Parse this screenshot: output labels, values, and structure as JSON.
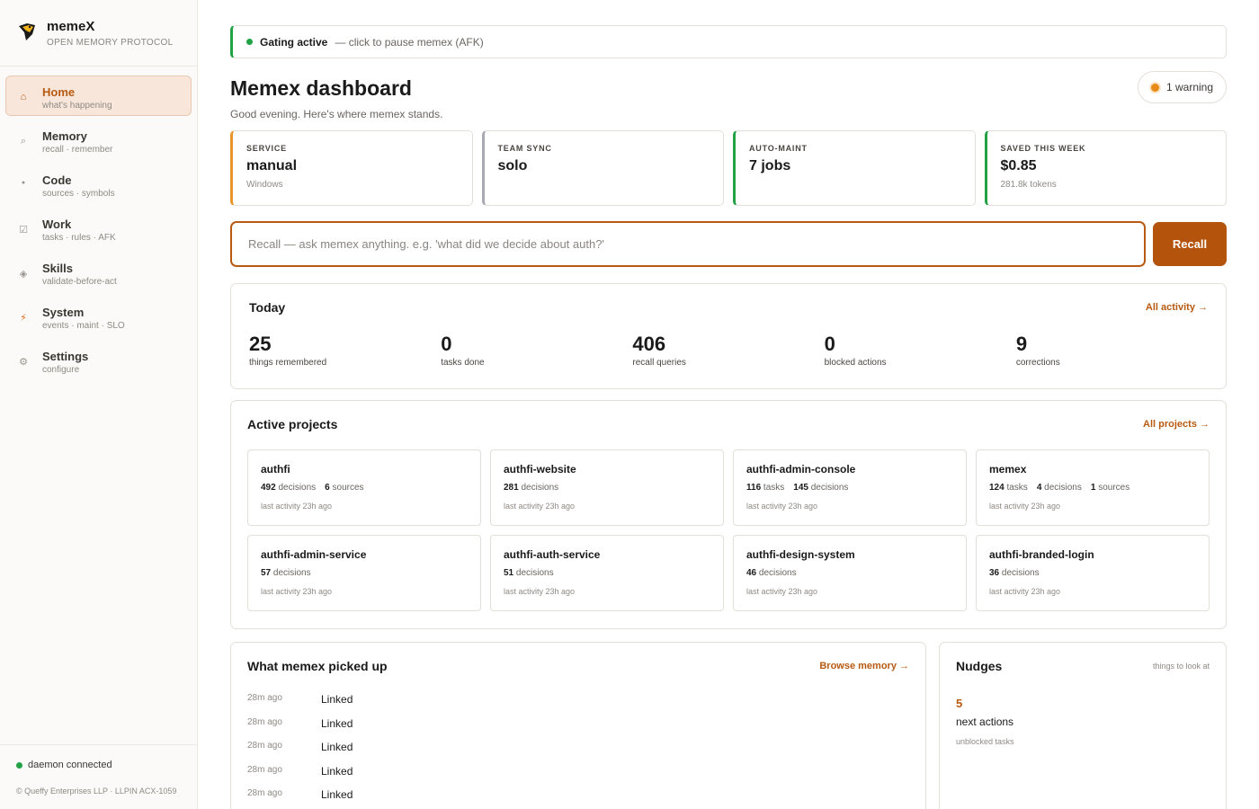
{
  "brand": {
    "name": "memeX",
    "subtitle": "OPEN MEMORY PROTOCOL"
  },
  "nav": [
    {
      "label": "Home",
      "sub": "what's happening",
      "icon": "⌂"
    },
    {
      "label": "Memory",
      "sub": "recall · remember",
      "icon": "⌕"
    },
    {
      "label": "Code",
      "sub": "sources · symbols",
      "icon": "●"
    },
    {
      "label": "Work",
      "sub": "tasks · rules · AFK",
      "icon": "☑"
    },
    {
      "label": "Skills",
      "sub": "validate-before-act",
      "icon": "◈"
    },
    {
      "label": "System",
      "sub": "events · maint · SLO",
      "icon": "⚡"
    },
    {
      "label": "Settings",
      "sub": "configure",
      "icon": "⚙"
    }
  ],
  "footer": {
    "status": "daemon connected",
    "copyright": "© Queffy Enterprises LLP · LLPIN ACX-1059"
  },
  "gating": {
    "title": "Gating active",
    "hint": "— click to pause memex (AFK)"
  },
  "header": {
    "title": "Memex dashboard",
    "subtitle": "Good evening. Here's where memex stands.",
    "warning": "1 warning"
  },
  "stats": [
    {
      "label": "SERVICE",
      "value": "manual",
      "sub": "Windows",
      "color": "#e8962c"
    },
    {
      "label": "TEAM SYNC",
      "value": "solo",
      "sub": "",
      "color": "#a8a8b0"
    },
    {
      "label": "AUTO-MAINT",
      "value": "7 jobs",
      "sub": "",
      "color": "#22a244"
    },
    {
      "label": "SAVED THIS WEEK",
      "value": "$0.85",
      "sub": "281.8k tokens",
      "color": "#22a244"
    }
  ],
  "recall": {
    "placeholder": "Recall — ask memex anything. e.g. 'what did we decide about auth?'",
    "button": "Recall"
  },
  "today": {
    "title": "Today",
    "link": "All activity →",
    "items": [
      {
        "value": "25",
        "label": "things remembered"
      },
      {
        "value": "0",
        "label": "tasks done"
      },
      {
        "value": "406",
        "label": "recall queries"
      },
      {
        "value": "0",
        "label": "blocked actions"
      },
      {
        "value": "9",
        "label": "corrections"
      }
    ]
  },
  "projects": {
    "title": "Active projects",
    "link": "All projects →",
    "items": [
      {
        "name": "authfi",
        "meta": [
          [
            "492",
            "decisions"
          ],
          [
            "6",
            "sources"
          ]
        ],
        "last": "last activity 23h ago"
      },
      {
        "name": "authfi-website",
        "meta": [
          [
            "281",
            "decisions"
          ]
        ],
        "last": "last activity 23h ago"
      },
      {
        "name": "authfi-admin-console",
        "meta": [
          [
            "116",
            "tasks"
          ],
          [
            "145",
            "decisions"
          ]
        ],
        "last": "last activity 23h ago"
      },
      {
        "name": "memex",
        "meta": [
          [
            "124",
            "tasks"
          ],
          [
            "4",
            "decisions"
          ],
          [
            "1",
            "sources"
          ]
        ],
        "last": "last activity 23h ago"
      },
      {
        "name": "authfi-admin-service",
        "meta": [
          [
            "57",
            "decisions"
          ]
        ],
        "last": "last activity 23h ago"
      },
      {
        "name": "authfi-auth-service",
        "meta": [
          [
            "51",
            "decisions"
          ]
        ],
        "last": "last activity 23h ago"
      },
      {
        "name": "authfi-design-system",
        "meta": [
          [
            "46",
            "decisions"
          ]
        ],
        "last": "last activity 23h ago"
      },
      {
        "name": "authfi-branded-login",
        "meta": [
          [
            "36",
            "decisions"
          ]
        ],
        "last": "last activity 23h ago"
      }
    ]
  },
  "picked": {
    "title": "What memex picked up",
    "link": "Browse memory →",
    "items": [
      {
        "time": "28m ago",
        "text": "Linked"
      },
      {
        "time": "28m ago",
        "text": "Linked"
      },
      {
        "time": "28m ago",
        "text": "Linked"
      },
      {
        "time": "28m ago",
        "text": "Linked"
      },
      {
        "time": "28m ago",
        "text": "Linked"
      }
    ]
  },
  "nudges": {
    "title": "Nudges",
    "sub": "things to look at",
    "value": "5",
    "label": "next actions",
    "detail": "unblocked tasks"
  }
}
